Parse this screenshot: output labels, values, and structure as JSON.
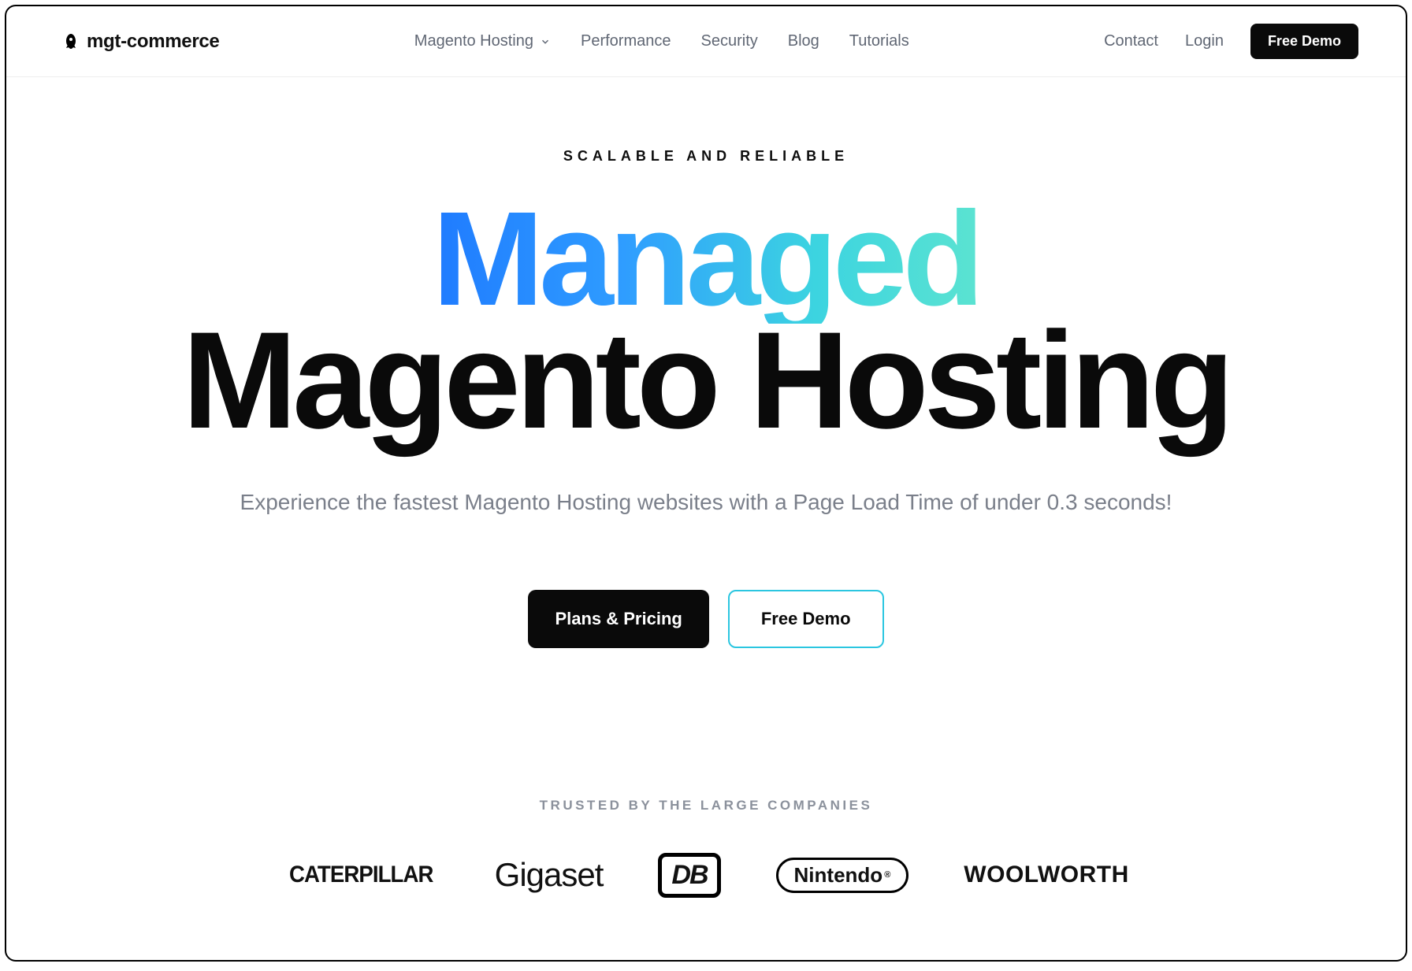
{
  "nav": {
    "brand": "mgt-commerce",
    "center": [
      {
        "label": "Magento Hosting",
        "dropdown": true
      },
      {
        "label": "Performance",
        "dropdown": false
      },
      {
        "label": "Security",
        "dropdown": false
      },
      {
        "label": "Blog",
        "dropdown": false
      },
      {
        "label": "Tutorials",
        "dropdown": false
      }
    ],
    "right": {
      "contact": "Contact",
      "login": "Login",
      "demo": "Free Demo"
    }
  },
  "hero": {
    "eyebrow": "SCALABLE AND RELIABLE",
    "managed": "Managed",
    "magento": "Magento Hosting",
    "sub": "Experience the fastest Magento Hosting websites with a Page Load Time of under 0.3 seconds!",
    "cta_primary": "Plans & Pricing",
    "cta_secondary": "Free Demo"
  },
  "trusted": {
    "label": "TRUSTED BY THE LARGE COMPANIES",
    "companies": [
      "CATERPILLAR",
      "Gigaset",
      "DB",
      "Nintendo",
      "WOOLWORTH"
    ]
  }
}
